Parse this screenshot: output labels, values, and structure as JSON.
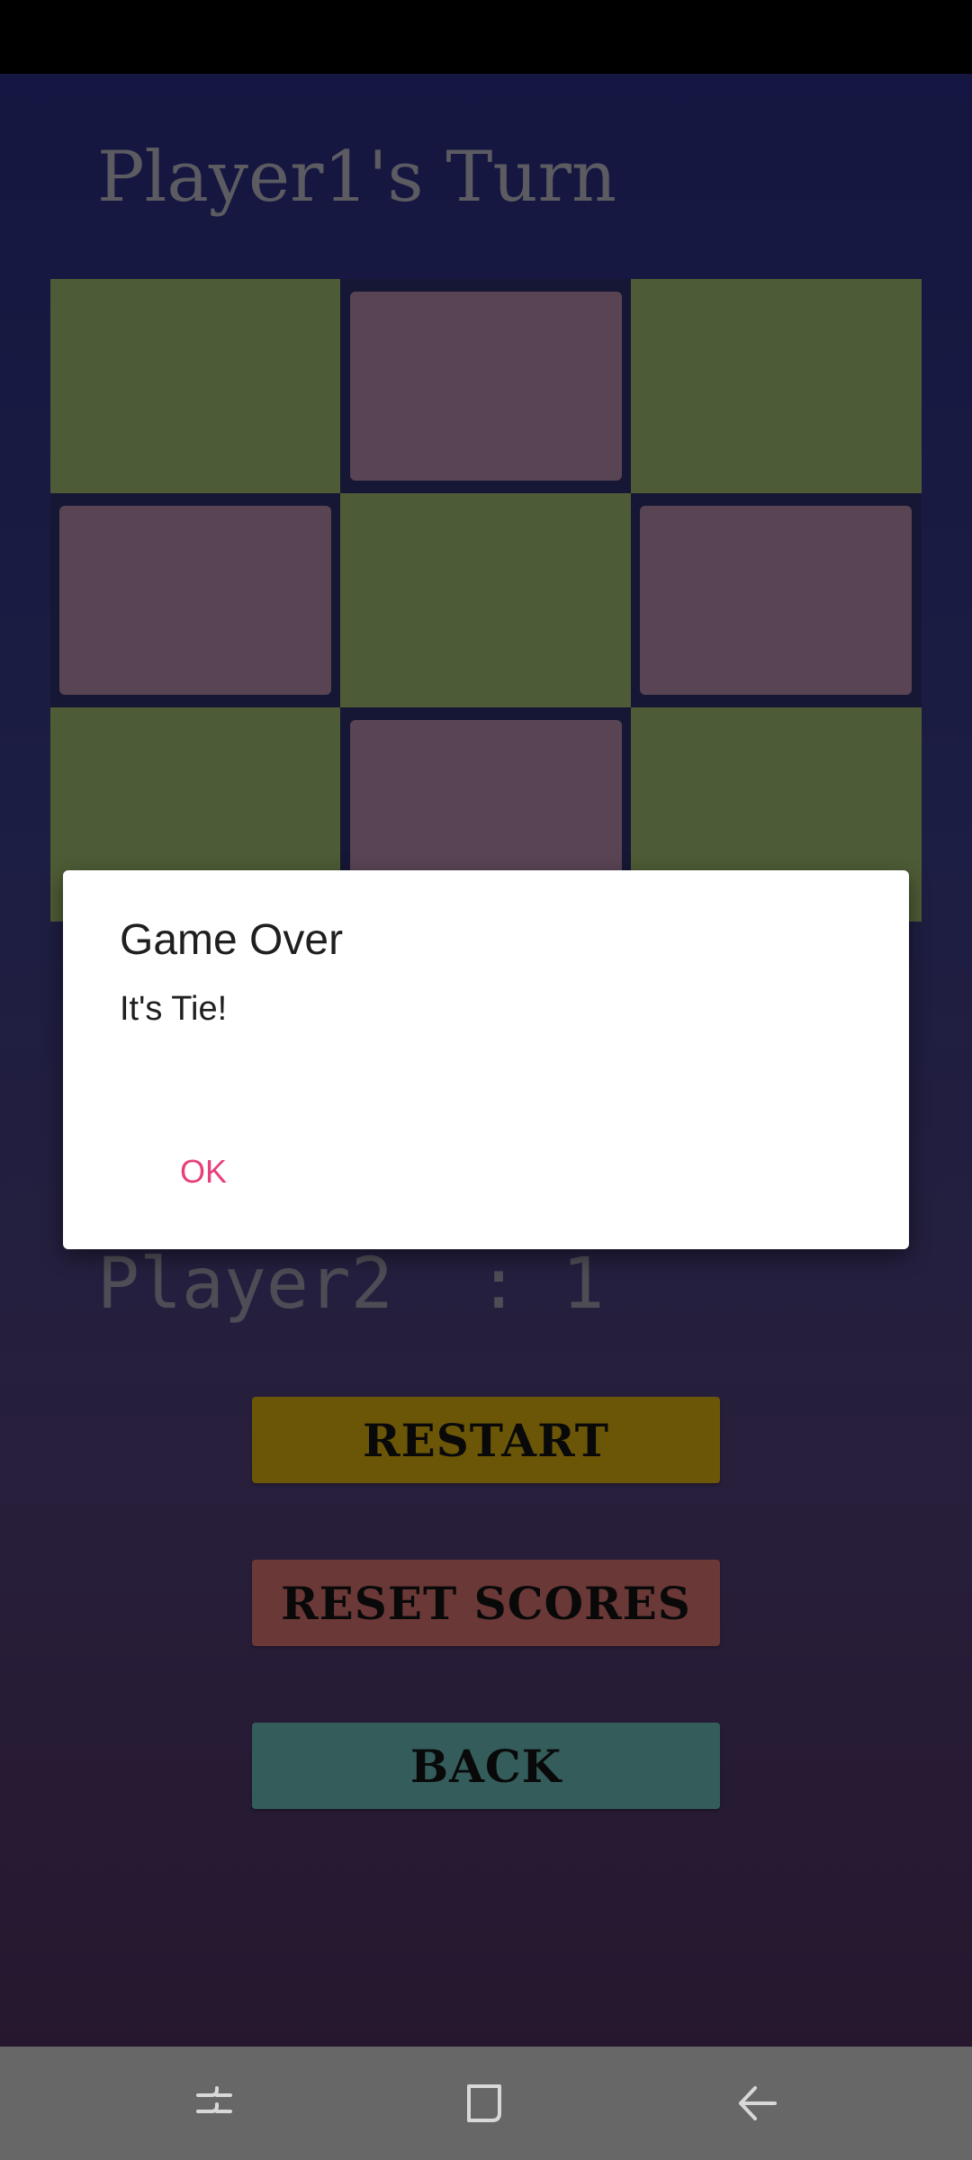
{
  "game": {
    "turn_title": "Player1's Turn",
    "board": [
      [
        "empty-green",
        "filled-pink",
        "empty-green"
      ],
      [
        "filled-pink",
        "empty-green",
        "filled-pink"
      ],
      [
        "empty-green",
        "filled-pink",
        "empty-green"
      ]
    ],
    "score_line": "Player2  : 1"
  },
  "buttons": {
    "restart": "RESTART",
    "reset_scores": "RESET SCORES",
    "back": "BACK"
  },
  "dialog": {
    "title": "Game Over",
    "message": "It's Tie!",
    "ok": "OK"
  },
  "navigation": {
    "recents": "recents-icon",
    "home": "home-icon",
    "back": "back-arrow-icon"
  },
  "colors": {
    "cell_green": "#9bb96c",
    "cell_pink": "#b289a8",
    "restart": "#d7ad0f",
    "reset_scores": "#d5716f",
    "back": "#66b8b6",
    "dialog_ok": "#e8407d"
  }
}
